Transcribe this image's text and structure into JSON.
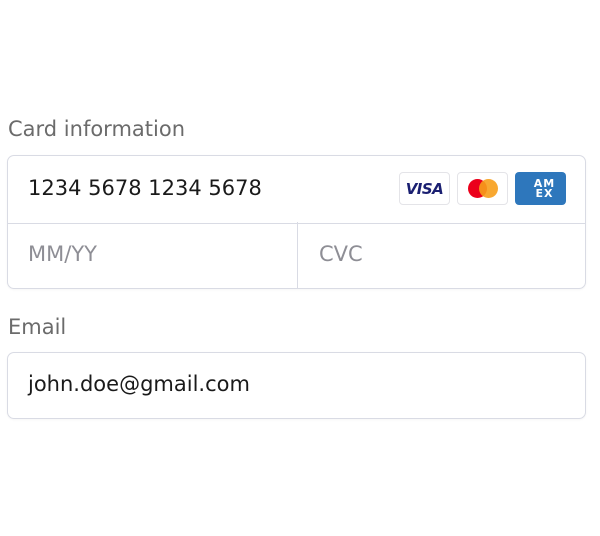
{
  "card": {
    "label": "Card information",
    "number_value": "1234 5678 1234 5678",
    "expiry_placeholder": "MM/YY",
    "cvc_placeholder": "CVC",
    "brands": [
      {
        "name": "visa",
        "text": "VISA",
        "color": "#1a1f71"
      },
      {
        "name": "mastercard",
        "colors": [
          "#eb001b",
          "#f79e1b"
        ]
      },
      {
        "name": "amex",
        "text": "AM EX",
        "color": "#2e77bc"
      }
    ]
  },
  "email": {
    "label": "Email",
    "value": "john.doe@gmail.com"
  }
}
